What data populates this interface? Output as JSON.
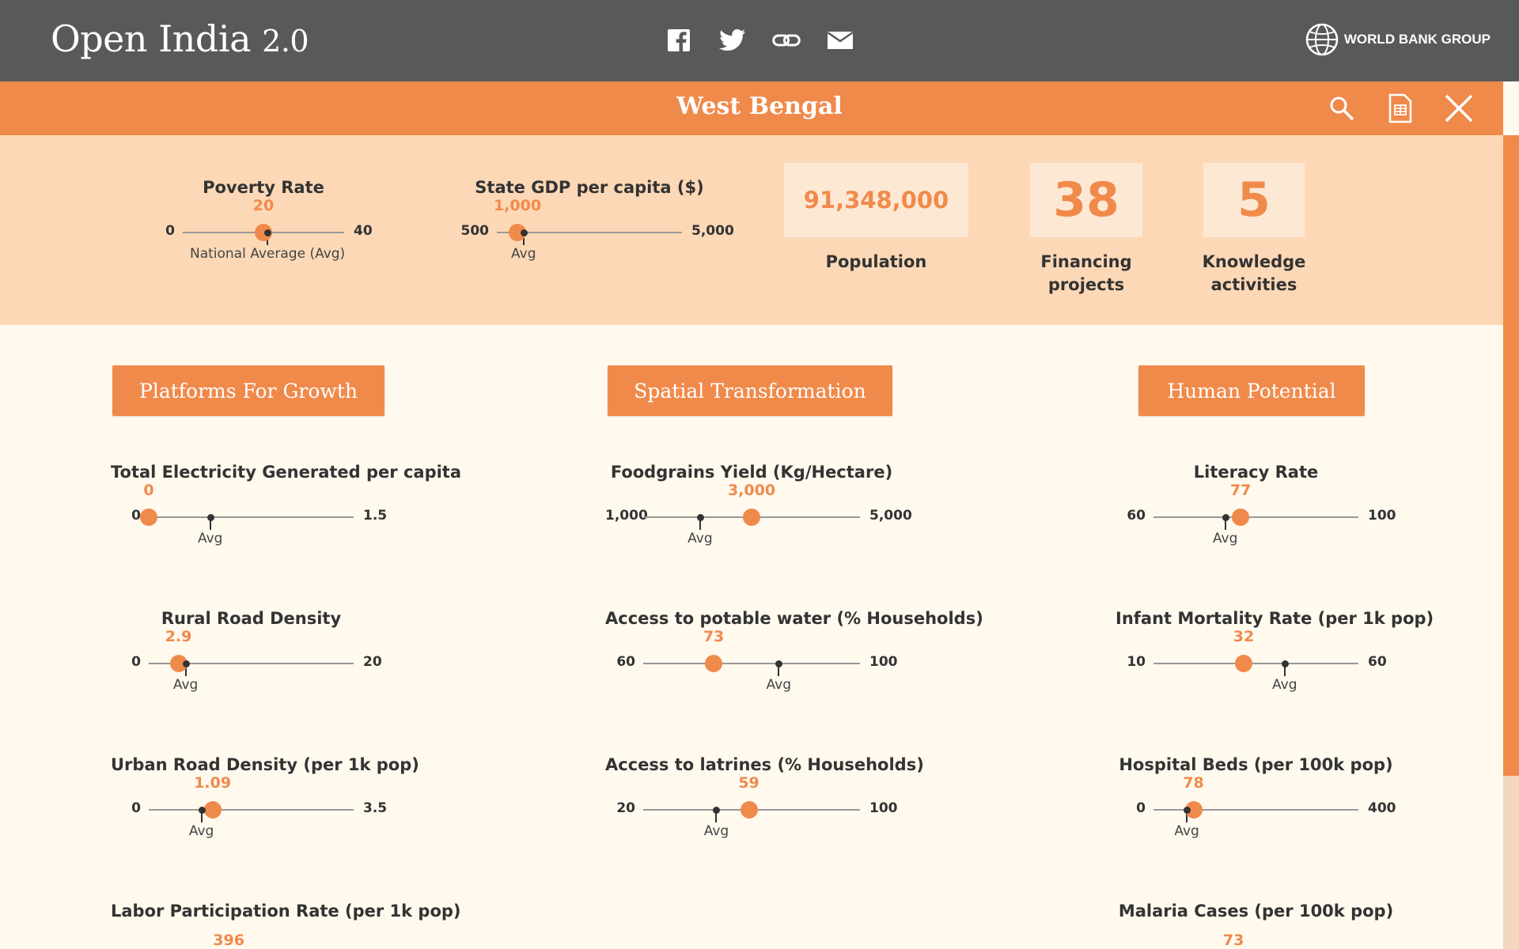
{
  "header": {
    "brand_main": "Open India",
    "brand_version": "2.0",
    "social_icons": [
      "facebook-icon",
      "twitter-icon",
      "link-icon",
      "mail-icon"
    ],
    "org_label": "WORLD BANK GROUP"
  },
  "state_bar": {
    "title": "West Bengal",
    "tools": [
      "search-icon",
      "spreadsheet-icon",
      "close-icon"
    ]
  },
  "summary": {
    "poverty": {
      "title": "Poverty Rate",
      "min": "0",
      "max": "40",
      "value": "20",
      "avg_label": "National Average (Avg)",
      "value_num": 20,
      "avg_num": 21,
      "min_num": 0,
      "max_num": 40
    },
    "gdp": {
      "title": "State GDP per capita ($)",
      "min": "500",
      "max": "5,000",
      "value": "1,000",
      "avg_label": "Avg",
      "value_num": 1000,
      "avg_num": 1150,
      "min_num": 500,
      "max_num": 5000
    },
    "population": {
      "value": "91,348,000",
      "label": "Population"
    },
    "financing": {
      "value": "38",
      "label_line1": "Financing",
      "label_line2": "projects"
    },
    "knowledge": {
      "value": "5",
      "label_line1": "Knowledge",
      "label_line2": "activities"
    }
  },
  "sections": [
    {
      "label": "Platforms For Growth"
    },
    {
      "label": "Spatial Transformation"
    },
    {
      "label": "Human Potential"
    }
  ],
  "indicators": {
    "col1": [
      {
        "title": "Total Electricity Generated per capita",
        "min": "0",
        "max": "1.5",
        "value": "0",
        "avg_label": "Avg",
        "value_num": 0,
        "avg_num": 0.45,
        "min_num": 0,
        "max_num": 1.5
      },
      {
        "title": "Rural Road Density",
        "min": "0",
        "max": "20",
        "value": "2.9",
        "avg_label": "Avg",
        "value_num": 2.9,
        "avg_num": 3.6,
        "min_num": 0,
        "max_num": 20
      },
      {
        "title": "Urban Road Density (per 1k pop)",
        "min": "0",
        "max": "3.5",
        "value": "1.09",
        "avg_label": "Avg",
        "value_num": 1.09,
        "avg_num": 0.9,
        "min_num": 0,
        "max_num": 3.5
      },
      {
        "title": "Labor Participation Rate (per 1k pop)",
        "value": "396"
      }
    ],
    "col2": [
      {
        "title": "Foodgrains Yield (Kg/Hectare)",
        "min": "1,000",
        "max": "5,000",
        "value": "3,000",
        "avg_label": "Avg",
        "value_num": 3000,
        "avg_num": 2050,
        "min_num": 1000,
        "max_num": 5000
      },
      {
        "title": "Access to potable water (% Households)",
        "min": "60",
        "max": "100",
        "value": "73",
        "avg_label": "Avg",
        "value_num": 73,
        "avg_num": 85,
        "min_num": 60,
        "max_num": 100
      },
      {
        "title": "Access to latrines (% Households)",
        "min": "20",
        "max": "100",
        "value": "59",
        "avg_label": "Avg",
        "value_num": 59,
        "avg_num": 47,
        "min_num": 20,
        "max_num": 100
      }
    ],
    "col3": [
      {
        "title": "Literacy Rate",
        "min": "60",
        "max": "100",
        "value": "77",
        "avg_label": "Avg",
        "value_num": 77,
        "avg_num": 74,
        "min_num": 60,
        "max_num": 100
      },
      {
        "title": "Infant Mortality Rate (per 1k pop)",
        "min": "10",
        "max": "60",
        "value": "32",
        "avg_label": "Avg",
        "value_num": 32,
        "avg_num": 42,
        "min_num": 10,
        "max_num": 60
      },
      {
        "title": "Hospital Beds (per 100k pop)",
        "min": "0",
        "max": "400",
        "value": "78",
        "avg_label": "Avg",
        "value_num": 78,
        "avg_num": 65,
        "min_num": 0,
        "max_num": 400
      },
      {
        "title": "Malaria Cases (per 100k pop)",
        "value": "73"
      }
    ]
  },
  "colors": {
    "accent": "#f08a4b",
    "header_bg": "#58595b",
    "summary_bg": "#fcd8b6",
    "page_bg": "#fff9ee"
  }
}
